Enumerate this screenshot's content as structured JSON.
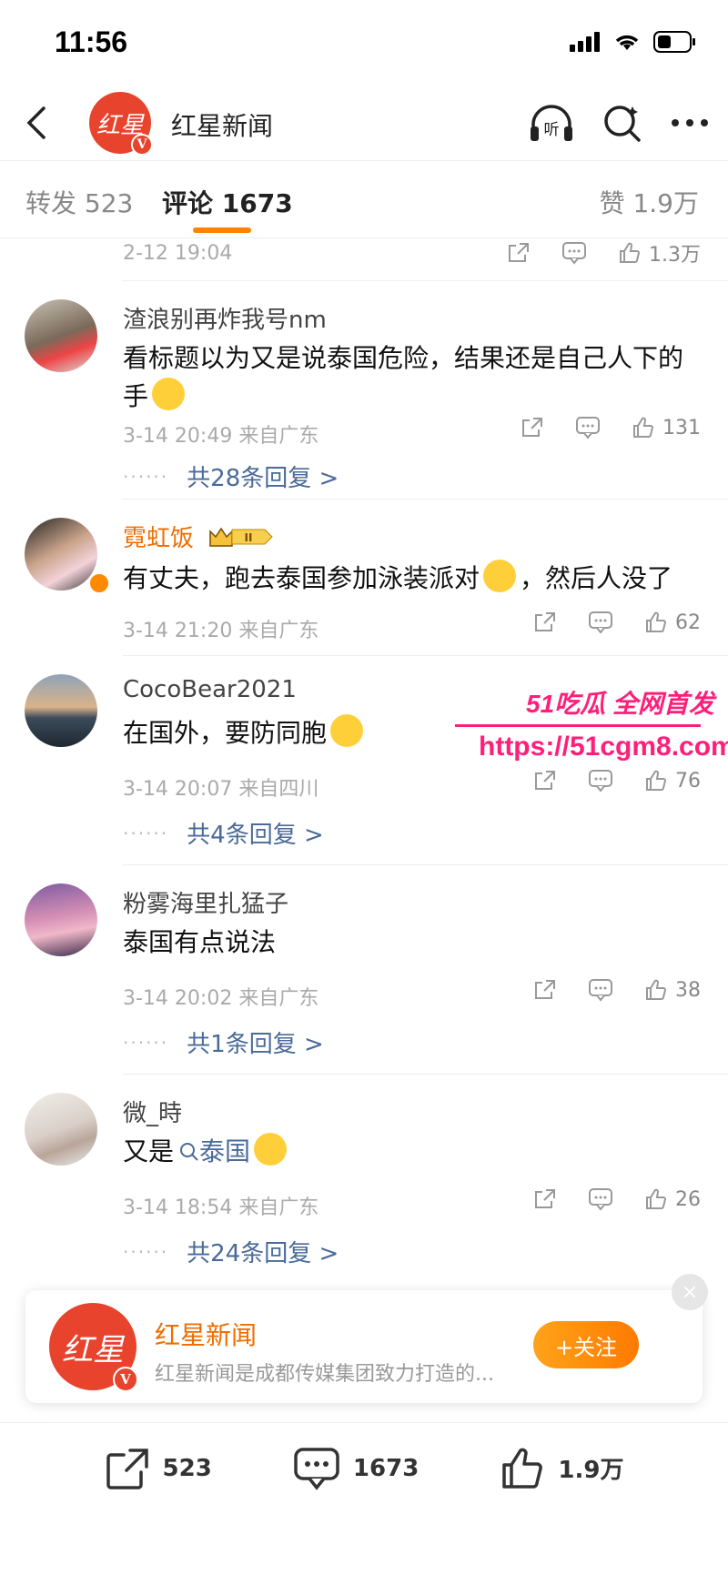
{
  "status_bar": {
    "time": "11:56"
  },
  "nav": {
    "title": "红星新闻",
    "logo_text": "红星",
    "verified": "V",
    "listen_label": "听"
  },
  "tabs": {
    "repost": "转发 523",
    "comments": "评论 1673",
    "likes": "赞 1.9万"
  },
  "prev_row": {
    "time": "2-12 19:04",
    "likes": "1.3万"
  },
  "comments": [
    {
      "user": "渣浪别再炸我号nm",
      "text": "看标题以为又是说泰国危险，结果还是自己人下的手",
      "time": "3-14 20:49 来自广东",
      "likes": "131",
      "reply": "共28条回复 >"
    },
    {
      "user": "霓虹饭",
      "text": "有丈夫，跑去泰国参加泳装派对",
      "text2": "，然后人没了",
      "time": "3-14 21:20 来自广东",
      "likes": "62"
    },
    {
      "user": "CocoBear2021",
      "text": "在国外，要防同胞",
      "time": "3-14 20:07 来自四川",
      "likes": "76",
      "reply": "共4条回复 >"
    },
    {
      "user": "粉雾海里扎猛子",
      "text": "泰国有点说法",
      "time": "3-14 20:02 来自广东",
      "likes": "38",
      "reply": "共1条回复 >"
    },
    {
      "user": "微_時",
      "text": "又是",
      "topic": "泰国",
      "time": "3-14 18:54 来自广东",
      "likes": "26",
      "reply": "共24条回复 >"
    }
  ],
  "reply_dots": "······",
  "follow_card": {
    "name": "红星新闻",
    "desc": "红星新闻是成都传媒集团致力打造的...",
    "follow_label": "+关注",
    "logo_text": "红星",
    "close": "×"
  },
  "bottom_bar": {
    "reposts": "523",
    "comments": "1673",
    "likes": "1.9万"
  },
  "watermark": {
    "line1": "51吃瓜 全网首发",
    "line2": "https://51cgm8.com"
  },
  "colors": {
    "accent": "#ff8200",
    "brand_red": "#e8432c",
    "link": "#4a6a9a"
  }
}
